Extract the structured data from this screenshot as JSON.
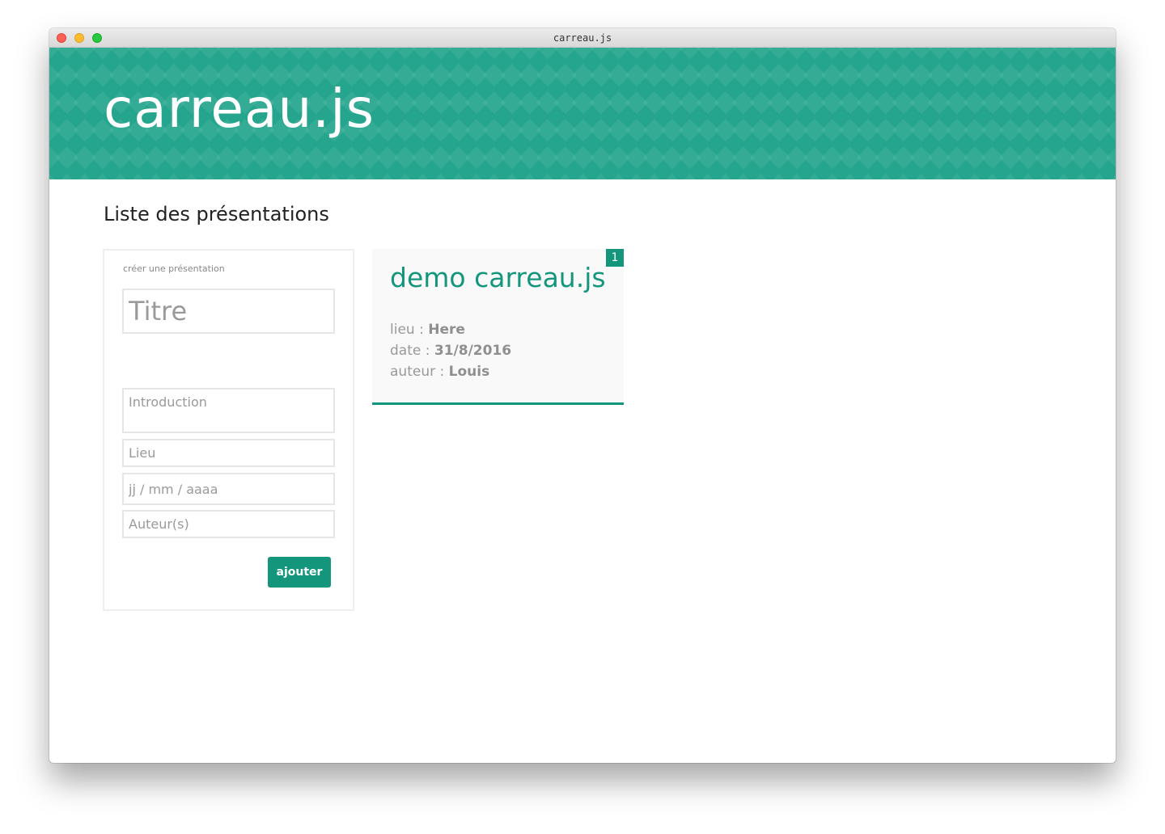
{
  "window": {
    "title": "carreau.js"
  },
  "header": {
    "brand": "carreau.js"
  },
  "main": {
    "heading": "Liste des présentations"
  },
  "form": {
    "caption": "créer une présentation",
    "title_placeholder": "Titre",
    "intro_placeholder": "Introduction",
    "lieu_placeholder": "Lieu",
    "date_placeholder": "jj / mm / aaaa",
    "auteur_placeholder": "Auteur(s)",
    "submit_label": "ajouter"
  },
  "presentations": [
    {
      "index": "1",
      "title": "demo carreau.js",
      "lieu_label": "lieu :",
      "lieu": "Here",
      "date_label": "date :",
      "date": "31/8/2016",
      "auteur_label": "auteur :",
      "auteur": "Louis"
    }
  ],
  "colors": {
    "accent": "#14967c",
    "banner": "#25a58d"
  }
}
